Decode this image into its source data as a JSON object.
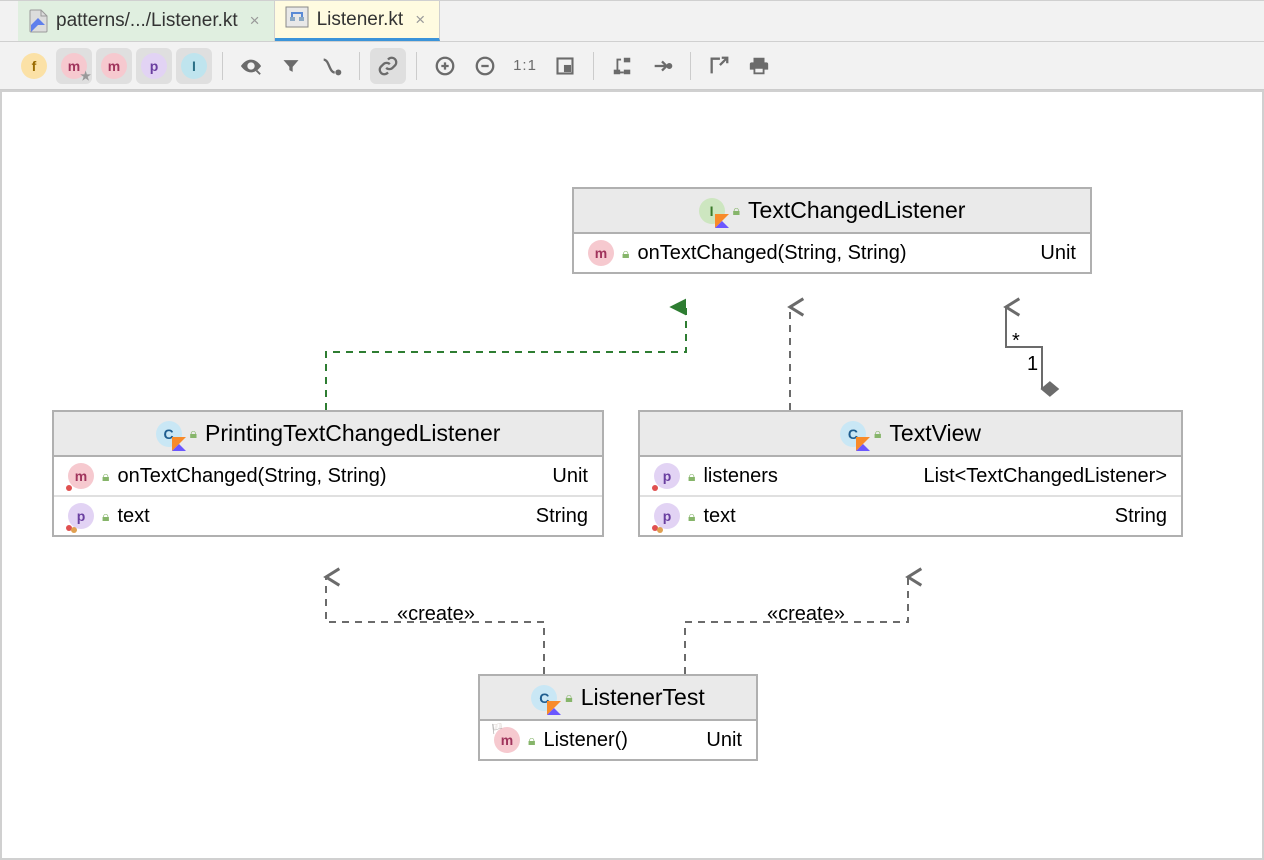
{
  "tabs": [
    {
      "label": "patterns/.../Listener.kt",
      "active": false
    },
    {
      "label": "Listener.kt",
      "active": true
    }
  ],
  "toolbar_filters": [
    "f",
    "m",
    "m",
    "p",
    "I"
  ],
  "classes": {
    "interface": {
      "name": "TextChangedListener",
      "members": [
        {
          "kind": "m",
          "name": "onTextChanged(String, String)",
          "type": "Unit"
        }
      ]
    },
    "printing": {
      "name": "PrintingTextChangedListener",
      "members": [
        {
          "kind": "m",
          "name": "onTextChanged(String, String)",
          "type": "Unit"
        }
      ],
      "props": [
        {
          "kind": "p",
          "name": "text",
          "type": "String"
        }
      ]
    },
    "textview": {
      "name": "TextView",
      "props": [
        {
          "kind": "p",
          "name": "listeners",
          "type": "List<TextChangedListener>"
        },
        {
          "kind": "p",
          "name": "text",
          "type": "String"
        }
      ]
    },
    "test": {
      "name": "ListenerTest",
      "members": [
        {
          "kind": "mg",
          "name": "Listener()",
          "type": "Unit"
        }
      ]
    }
  },
  "edges": {
    "create_label": "«create»",
    "mult_star": "*",
    "mult_one": "1"
  }
}
